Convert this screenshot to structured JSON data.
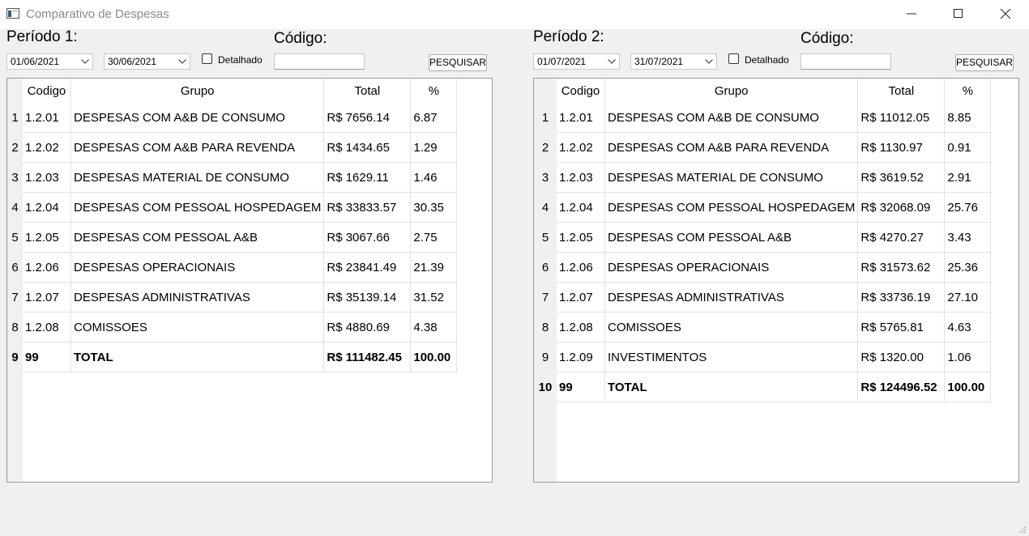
{
  "window": {
    "title": "Comparativo de Despesas",
    "accent": "#1a5fb4"
  },
  "left": {
    "periodo_label": "Período 1:",
    "codigo_label": "Código:",
    "date_from": "01/06/2021",
    "date_to": "30/06/2021",
    "detalhado_label": "Detalhado",
    "codigo_value": "",
    "search_label": "PESQUISAR",
    "headers": [
      "Codigo",
      "Grupo",
      "Total",
      "%"
    ],
    "rows": [
      {
        "n": "1",
        "codigo": "1.2.01",
        "grupo": "DESPESAS COM A&B DE CONSUMO",
        "total": "R$ 7656.14",
        "pct": "6.87"
      },
      {
        "n": "2",
        "codigo": "1.2.02",
        "grupo": "DESPESAS COM A&B PARA REVENDA",
        "total": "R$ 1434.65",
        "pct": "1.29"
      },
      {
        "n": "3",
        "codigo": "1.2.03",
        "grupo": "DESPESAS MATERIAL DE CONSUMO",
        "total": "R$ 1629.11",
        "pct": "1.46"
      },
      {
        "n": "4",
        "codigo": "1.2.04",
        "grupo": "DESPESAS COM PESSOAL HOSPEDAGEM",
        "total": "R$ 33833.57",
        "pct": "30.35"
      },
      {
        "n": "5",
        "codigo": "1.2.05",
        "grupo": "DESPESAS COM PESSOAL A&B",
        "total": "R$ 3067.66",
        "pct": "2.75"
      },
      {
        "n": "6",
        "codigo": "1.2.06",
        "grupo": "DESPESAS OPERACIONAIS",
        "total": "R$ 23841.49",
        "pct": "21.39"
      },
      {
        "n": "7",
        "codigo": "1.2.07",
        "grupo": "DESPESAS ADMINISTRATIVAS",
        "total": "R$ 35139.14",
        "pct": "31.52"
      },
      {
        "n": "8",
        "codigo": "1.2.08",
        "grupo": "COMISSOES",
        "total": "R$ 4880.69",
        "pct": "4.38"
      },
      {
        "n": "9",
        "codigo": "99",
        "grupo": "TOTAL",
        "total": "R$ 111482.45",
        "pct": "100.00",
        "bold": true
      }
    ]
  },
  "right": {
    "periodo_label": "Período 2:",
    "codigo_label": "Código:",
    "date_from": "01/07/2021",
    "date_to": "31/07/2021",
    "detalhado_label": "Detalhado",
    "codigo_value": "",
    "search_label": "PESQUISAR",
    "headers": [
      "Codigo",
      "Grupo",
      "Total",
      "%"
    ],
    "rows": [
      {
        "n": "1",
        "codigo": "1.2.01",
        "grupo": "DESPESAS COM A&B DE CONSUMO",
        "total": "R$ 11012.05",
        "pct": "8.85"
      },
      {
        "n": "2",
        "codigo": "1.2.02",
        "grupo": "DESPESAS COM A&B PARA REVENDA",
        "total": "R$ 1130.97",
        "pct": "0.91"
      },
      {
        "n": "3",
        "codigo": "1.2.03",
        "grupo": "DESPESAS MATERIAL DE CONSUMO",
        "total": "R$ 3619.52",
        "pct": "2.91"
      },
      {
        "n": "4",
        "codigo": "1.2.04",
        "grupo": "DESPESAS COM PESSOAL HOSPEDAGEM",
        "total": "R$ 32068.09",
        "pct": "25.76"
      },
      {
        "n": "5",
        "codigo": "1.2.05",
        "grupo": "DESPESAS COM PESSOAL A&B",
        "total": "R$ 4270.27",
        "pct": "3.43"
      },
      {
        "n": "6",
        "codigo": "1.2.06",
        "grupo": "DESPESAS OPERACIONAIS",
        "total": "R$ 31573.62",
        "pct": "25.36"
      },
      {
        "n": "7",
        "codigo": "1.2.07",
        "grupo": "DESPESAS ADMINISTRATIVAS",
        "total": "R$ 33736.19",
        "pct": "27.10"
      },
      {
        "n": "8",
        "codigo": "1.2.08",
        "grupo": "COMISSOES",
        "total": "R$ 5765.81",
        "pct": "4.63"
      },
      {
        "n": "9",
        "codigo": "1.2.09",
        "grupo": "INVESTIMENTOS",
        "total": "R$ 1320.00",
        "pct": "1.06"
      },
      {
        "n": "10",
        "codigo": "99",
        "grupo": "TOTAL",
        "total": "R$ 124496.52",
        "pct": "100.00",
        "bold": true
      }
    ]
  }
}
